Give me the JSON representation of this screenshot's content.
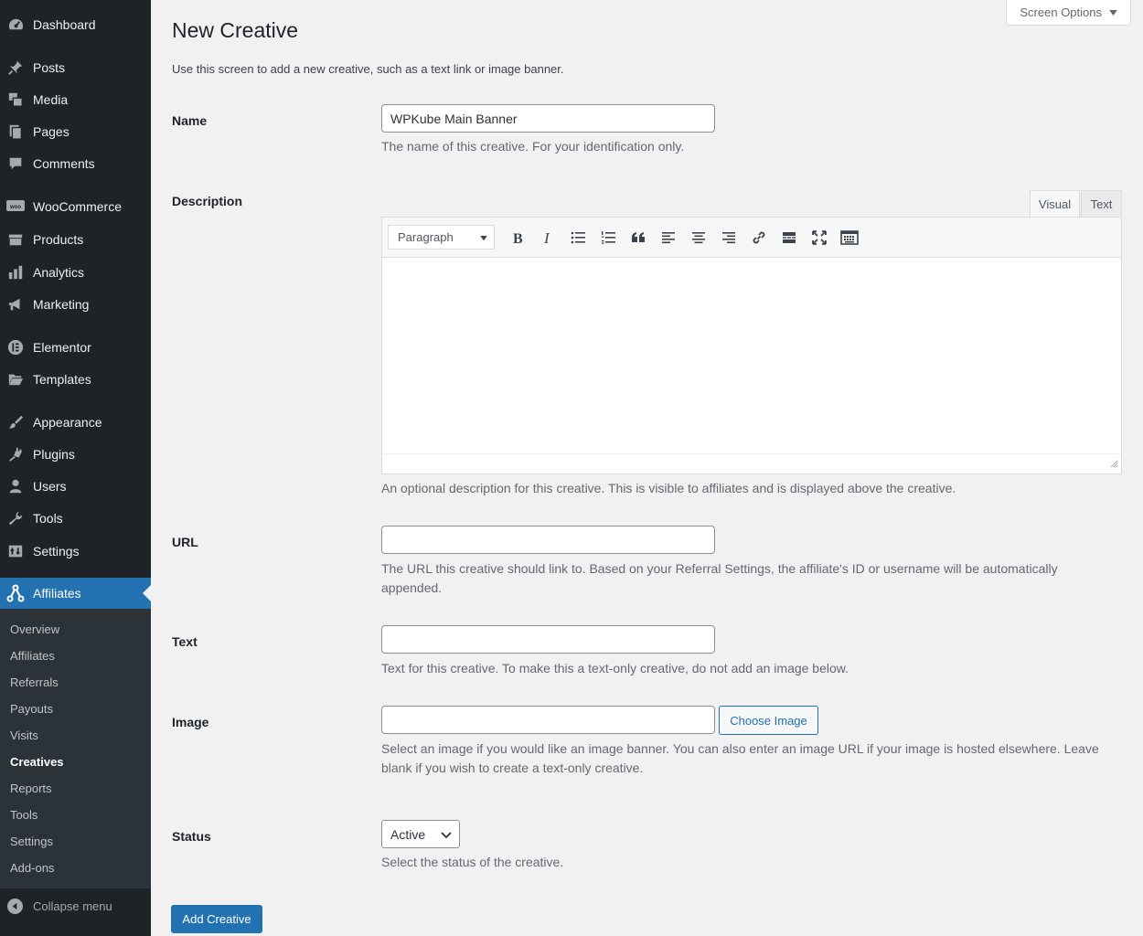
{
  "sidebar": {
    "items": [
      {
        "name": "dashboard",
        "label": "Dashboard",
        "icon": "dashboard-icon"
      },
      {
        "name": "posts",
        "label": "Posts",
        "icon": "pin-icon"
      },
      {
        "name": "media",
        "label": "Media",
        "icon": "media-icon"
      },
      {
        "name": "pages",
        "label": "Pages",
        "icon": "pages-icon"
      },
      {
        "name": "comments",
        "label": "Comments",
        "icon": "comments-icon"
      },
      {
        "name": "woocommerce",
        "label": "WooCommerce",
        "icon": "woocommerce-icon"
      },
      {
        "name": "products",
        "label": "Products",
        "icon": "products-icon"
      },
      {
        "name": "analytics",
        "label": "Analytics",
        "icon": "analytics-icon"
      },
      {
        "name": "marketing",
        "label": "Marketing",
        "icon": "megaphone-icon"
      },
      {
        "name": "elementor",
        "label": "Elementor",
        "icon": "elementor-icon"
      },
      {
        "name": "templates",
        "label": "Templates",
        "icon": "folder-icon"
      },
      {
        "name": "appearance",
        "label": "Appearance",
        "icon": "paintbrush-icon"
      },
      {
        "name": "plugins",
        "label": "Plugins",
        "icon": "plug-icon"
      },
      {
        "name": "users",
        "label": "Users",
        "icon": "user-icon"
      },
      {
        "name": "tools",
        "label": "Tools",
        "icon": "wrench-icon"
      },
      {
        "name": "settings",
        "label": "Settings",
        "icon": "settings-icon"
      },
      {
        "name": "affiliates",
        "label": "Affiliates",
        "icon": "affiliates-icon"
      }
    ],
    "submenu": [
      {
        "label": "Overview"
      },
      {
        "label": "Affiliates"
      },
      {
        "label": "Referrals"
      },
      {
        "label": "Payouts"
      },
      {
        "label": "Visits"
      },
      {
        "label": "Creatives"
      },
      {
        "label": "Reports"
      },
      {
        "label": "Tools"
      },
      {
        "label": "Settings"
      },
      {
        "label": "Add-ons"
      }
    ],
    "collapse_label": "Collapse menu"
  },
  "header": {
    "screen_options": "Screen Options",
    "title": "New Creative",
    "intro": "Use this screen to add a new creative, such as a text link or image banner."
  },
  "form": {
    "name": {
      "label": "Name",
      "value": "WPKube Main Banner",
      "help": "The name of this creative. For your identification only."
    },
    "description": {
      "label": "Description",
      "tab_visual": "Visual",
      "tab_text": "Text",
      "format": "Paragraph",
      "help": "An optional description for this creative. This is visible to affiliates and is displayed above the creative."
    },
    "url": {
      "label": "URL",
      "value": "",
      "help": "The URL this creative should link to. Based on your Referral Settings, the affiliate's ID or username will be automatically appended."
    },
    "text": {
      "label": "Text",
      "value": "",
      "help": "Text for this creative. To make this a text-only creative, do not add an image below."
    },
    "image": {
      "label": "Image",
      "value": "",
      "button": "Choose Image",
      "help": "Select an image if you would like an image banner. You can also enter an image URL if your image is hosted elsewhere. Leave blank if you wish to create a text-only creative."
    },
    "status": {
      "label": "Status",
      "value": "Active",
      "help": "Select the status of the creative."
    },
    "submit": "Add Creative"
  },
  "colors": {
    "sidebar_bg": "#1d2327",
    "submenu_bg": "#2c3338",
    "accent": "#2271b1",
    "page_bg": "#f1f1f1"
  }
}
